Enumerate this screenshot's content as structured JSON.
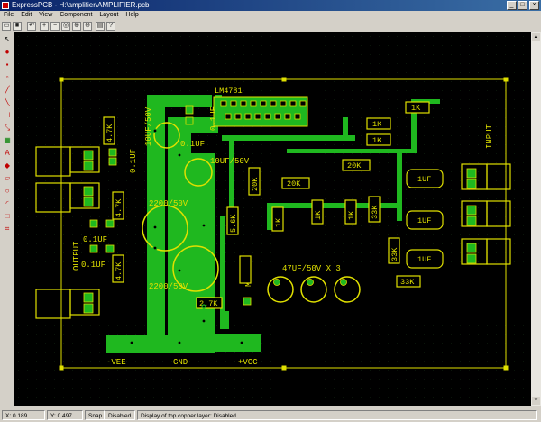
{
  "window": {
    "title": "ExpressPCB - H:\\amplifier\\AMPLIFIER.pcb"
  },
  "menu": [
    "File",
    "Edit",
    "View",
    "Component",
    "Layout",
    "Help"
  ],
  "status": {
    "x": "X: 0.189",
    "y": "Y: 0.497",
    "snap_label": "Snap",
    "snap_value": "Disabled",
    "layer_info": "Display of top copper layer: Disabled"
  },
  "board": {
    "chip_label": "LM4781",
    "labels": {
      "output": "OUTPUT",
      "input": "INPUT",
      "vee": "-VEE",
      "gnd": "GND",
      "vcc": "+VCC",
      "mute": "MUTE",
      "caps_row": "47UF/50V X 3",
      "cap_10uf_a": "10UF/50V",
      "cap_10uf_b": "10UF/50V",
      "cap_2200_a": "2200/50V",
      "cap_2200_b": "2200/50V",
      "cap_01_top": "0.1UF",
      "cap_01_mid": "0.1UF",
      "cap_01_left": "0.1UF",
      "cap_01_out1": "0.1UF",
      "cap_01_out2": "0.1UF"
    },
    "resistors": {
      "r_4k7_a": "4.7K",
      "r_4k7_b": "4.7K",
      "r_4k7_c": "4.7K",
      "r_1k_top": "1K",
      "r_1k_a": "1K",
      "r_1k_b": "1K",
      "r_20k_a": "20K",
      "r_20k_b": "20K",
      "r_20k_c": "20K",
      "r_1k_v1": "1K",
      "r_1k_v2": "1K",
      "r_1k_v3": "1K",
      "r_33k_a": "33K",
      "r_33k_b": "33K",
      "r_33k_c": "33K",
      "r_5k6": "5.6K",
      "r_2k7": "2.7K"
    },
    "input_caps": {
      "c1": "1UF",
      "c2": "1UF",
      "c3": "1UF"
    }
  }
}
